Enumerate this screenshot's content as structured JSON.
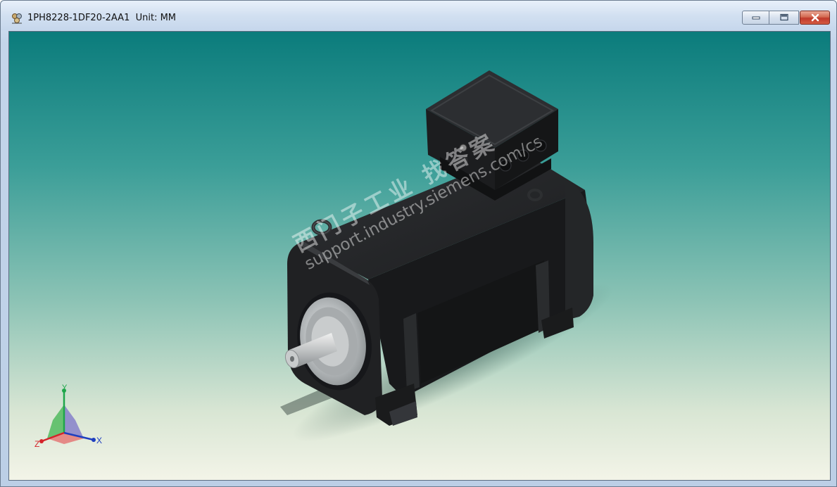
{
  "window": {
    "title": "1PH8228-1DF20-2AA1  Unit: MM",
    "icon": "model-viewer-icon",
    "controls": {
      "minimize": "minimize-icon",
      "maximize": "maximize-icon",
      "close": "close-icon"
    }
  },
  "viewport": {
    "model_name": "motor-3d-model",
    "watermark": {
      "line1": "西门子工业  找答案",
      "line2": "support.industry.siemens.com/cs"
    },
    "axis_triad": {
      "x": "X",
      "y": "Y",
      "z": "Z"
    }
  },
  "colors": {
    "background_top": "#0b7c7c",
    "background_bottom": "#f3f4e8",
    "motor_body": "#1b1c1e",
    "flange": "#b8bcbe",
    "axis_x": "#1f3fbf",
    "axis_y": "#1fa64a",
    "axis_z": "#d4242a"
  }
}
